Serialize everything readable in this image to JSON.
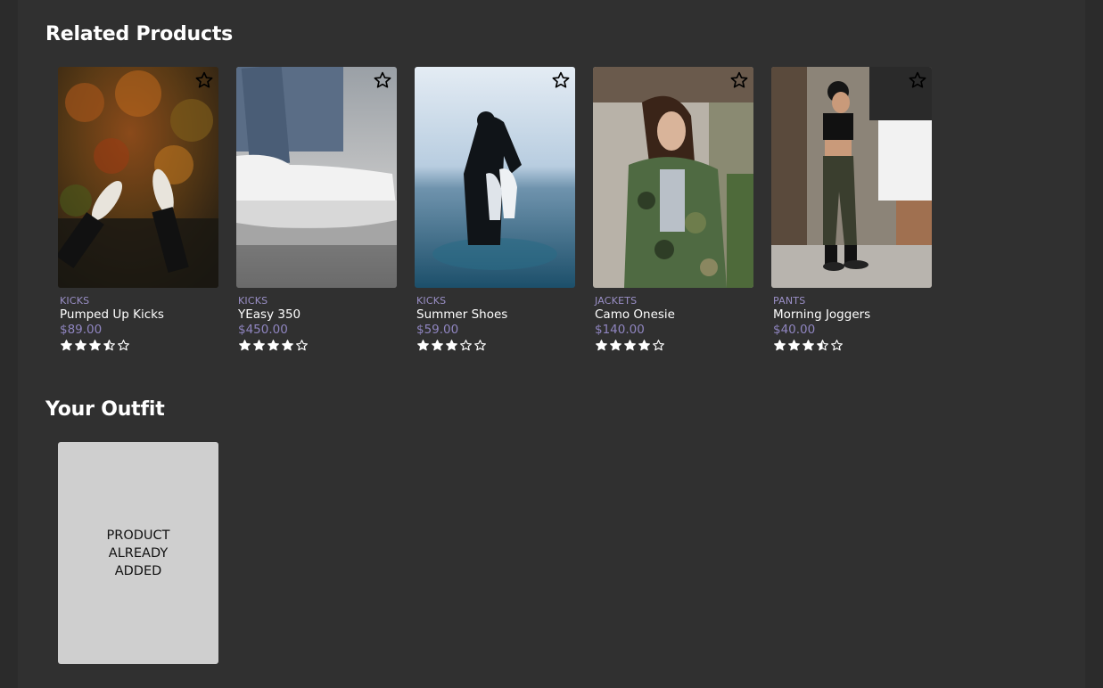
{
  "related": {
    "title": "Related Products",
    "products": [
      {
        "category": "KICKS",
        "name": "Pumped Up Kicks",
        "price": "$89.00",
        "rating": 3.5,
        "image": "sneakers-in-autumn-forest"
      },
      {
        "category": "KICKS",
        "name": "YEasy 350",
        "price": "$450.00",
        "rating": 4,
        "image": "white-yeezy-sneaker-closeup"
      },
      {
        "category": "KICKS",
        "name": "Summer Shoes",
        "price": "$59.00",
        "rating": 3,
        "image": "person-in-sea-holding-shoes"
      },
      {
        "category": "JACKETS",
        "name": "Camo Onesie",
        "price": "$140.00",
        "rating": 4,
        "image": "woman-in-camo-jacket"
      },
      {
        "category": "PANTS",
        "name": "Morning Joggers",
        "price": "$40.00",
        "rating": 3.5,
        "image": "woman-in-joggers"
      }
    ]
  },
  "outfit": {
    "title": "Your Outfit",
    "message": "PRODUCT ALREADY ADDED"
  },
  "colors": {
    "background": "#303030",
    "category": "#9a8fc6",
    "price": "#8f85c0",
    "placeholder": "#cfcfcf"
  },
  "icons": {
    "favorite": "star-outline-icon",
    "rating_full": "star-filled-icon",
    "rating_half": "star-half-icon",
    "rating_empty": "star-empty-icon"
  }
}
